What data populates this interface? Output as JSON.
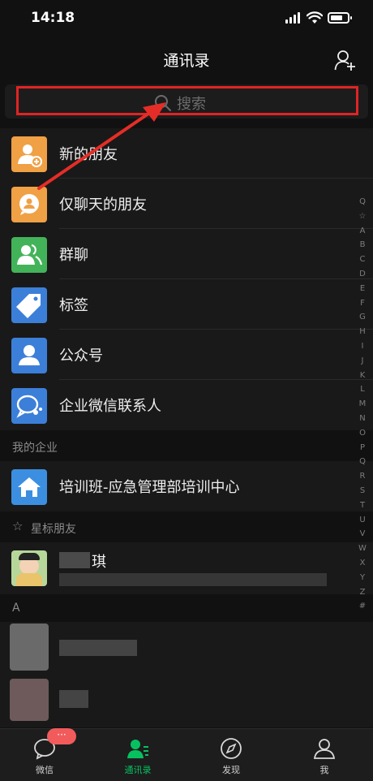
{
  "status_bar": {
    "time": "14:18"
  },
  "nav": {
    "title": "通讯录",
    "add_icon": "add-contact-icon"
  },
  "search": {
    "placeholder": "搜索",
    "icon": "search-icon"
  },
  "contacts_menu": [
    {
      "label": "新的朋友",
      "icon": "new-friend-icon",
      "color": "#f0a045"
    },
    {
      "label": "仅聊天的朋友",
      "icon": "chat-only-friend-icon",
      "color": "#f0a045"
    },
    {
      "label": "群聊",
      "icon": "group-chat-icon",
      "color": "#43b35a"
    },
    {
      "label": "标签",
      "icon": "tag-icon",
      "color": "#3c7fd8"
    },
    {
      "label": "公众号",
      "icon": "official-account-icon",
      "color": "#3c7fd8"
    },
    {
      "label": "企业微信联系人",
      "icon": "work-wechat-icon",
      "color": "#3c7fd8"
    }
  ],
  "sections": {
    "my_enterprise": "我的企业",
    "starred": "星标朋友",
    "letter_a": "A"
  },
  "enterprise": {
    "label": "培训班-应急管理部培训中心",
    "icon": "home-icon",
    "color": "#3c8fe0"
  },
  "starred_contact": {
    "name_suffix": "琪"
  },
  "index_letters": [
    "Q",
    "☆",
    "A",
    "B",
    "C",
    "D",
    "E",
    "F",
    "G",
    "H",
    "I",
    "J",
    "K",
    "L",
    "M",
    "N",
    "O",
    "P",
    "Q",
    "R",
    "S",
    "T",
    "U",
    "V",
    "W",
    "X",
    "Y",
    "Z",
    "#"
  ],
  "tabbar": {
    "tabs": [
      {
        "label": "微信",
        "icon": "chat-bubble-icon"
      },
      {
        "label": "通讯录",
        "icon": "contacts-icon"
      },
      {
        "label": "发现",
        "icon": "compass-icon"
      },
      {
        "label": "我",
        "icon": "profile-icon"
      }
    ],
    "badge": "···",
    "active_color": "#07c160"
  }
}
